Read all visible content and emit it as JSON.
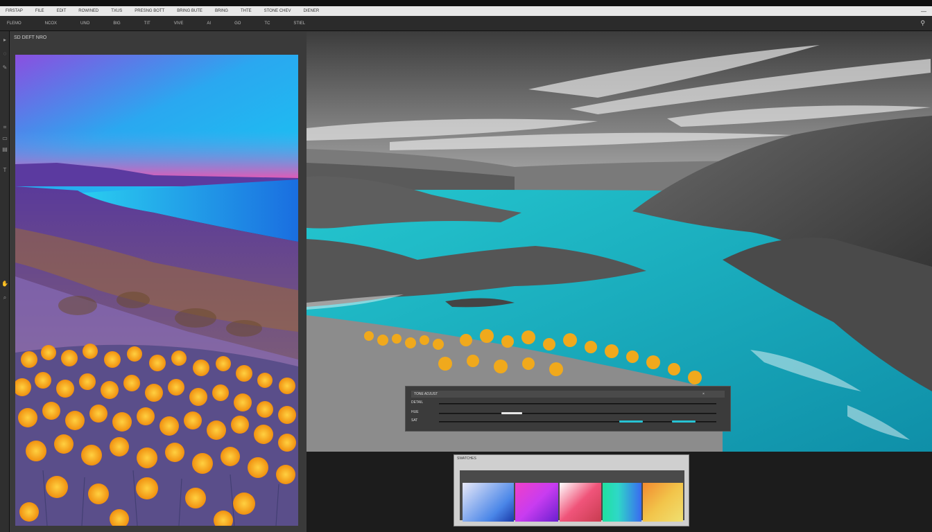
{
  "titlebar": {
    "items": [
      "FIRSTAP",
      "FILE",
      "EDIT",
      "ROWINED",
      "TXUS",
      "PRESNG BOTT",
      "BRING BUTE",
      "BRING",
      "THTE",
      "STONE CHEV",
      "DIENER"
    ]
  },
  "menubar": {
    "items": [
      "FLEMO",
      "NCOX",
      "UNO",
      "BIG",
      "TIT",
      "VIVE",
      "AI",
      "GO",
      "TC",
      "STIEL"
    ]
  },
  "document": {
    "tab_label": "SD DEFT NRO"
  },
  "dialog": {
    "title": "TONE ADJUST",
    "labels": [
      "DETAIL",
      "HUE",
      "SAT"
    ]
  },
  "swatches": {
    "title": "SWATCHES",
    "colors": [
      "#4a86e8",
      "#c83cf0",
      "#f0547a",
      "#2fd8c8",
      "#f2c44a"
    ]
  },
  "accent": "#27c3d4"
}
